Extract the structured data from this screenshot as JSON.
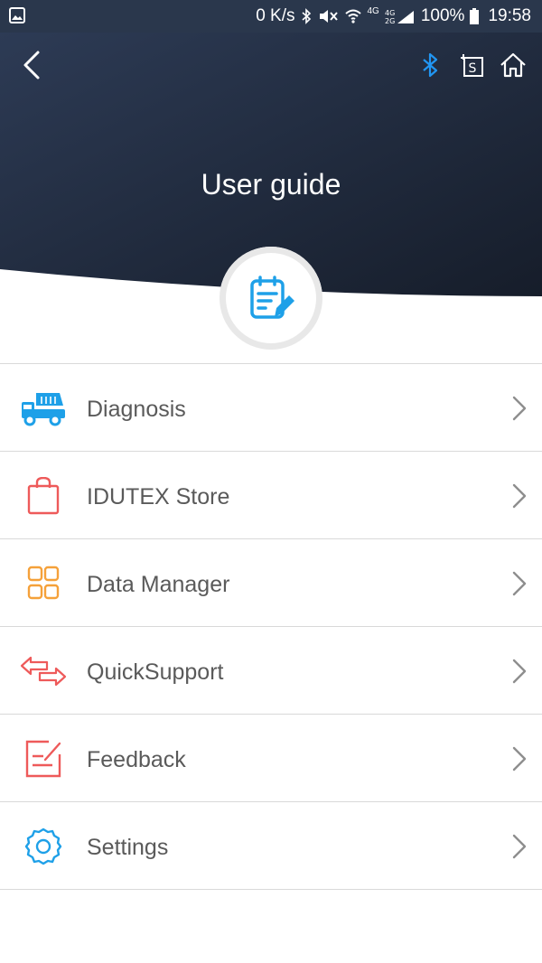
{
  "status_bar": {
    "net_speed": "0 K/s",
    "signal_4g_label": "4G",
    "battery": "100%",
    "time": "19:58"
  },
  "header": {
    "title": "User guide",
    "bluetooth_color": "#2196f3"
  },
  "menu": {
    "items": [
      {
        "label": "Diagnosis",
        "icon": "truck-icon"
      },
      {
        "label": "IDUTEX Store",
        "icon": "shopping-bag-icon"
      },
      {
        "label": "Data Manager",
        "icon": "grid-icon"
      },
      {
        "label": "QuickSupport",
        "icon": "swap-arrows-icon"
      },
      {
        "label": "Feedback",
        "icon": "edit-note-icon"
      },
      {
        "label": "Settings",
        "icon": "gear-icon"
      }
    ]
  },
  "colors": {
    "header_dark": "#1c2434",
    "accent_blue": "#1ea0e8",
    "accent_red": "#ee5a5a",
    "accent_orange": "#f5a13a"
  }
}
